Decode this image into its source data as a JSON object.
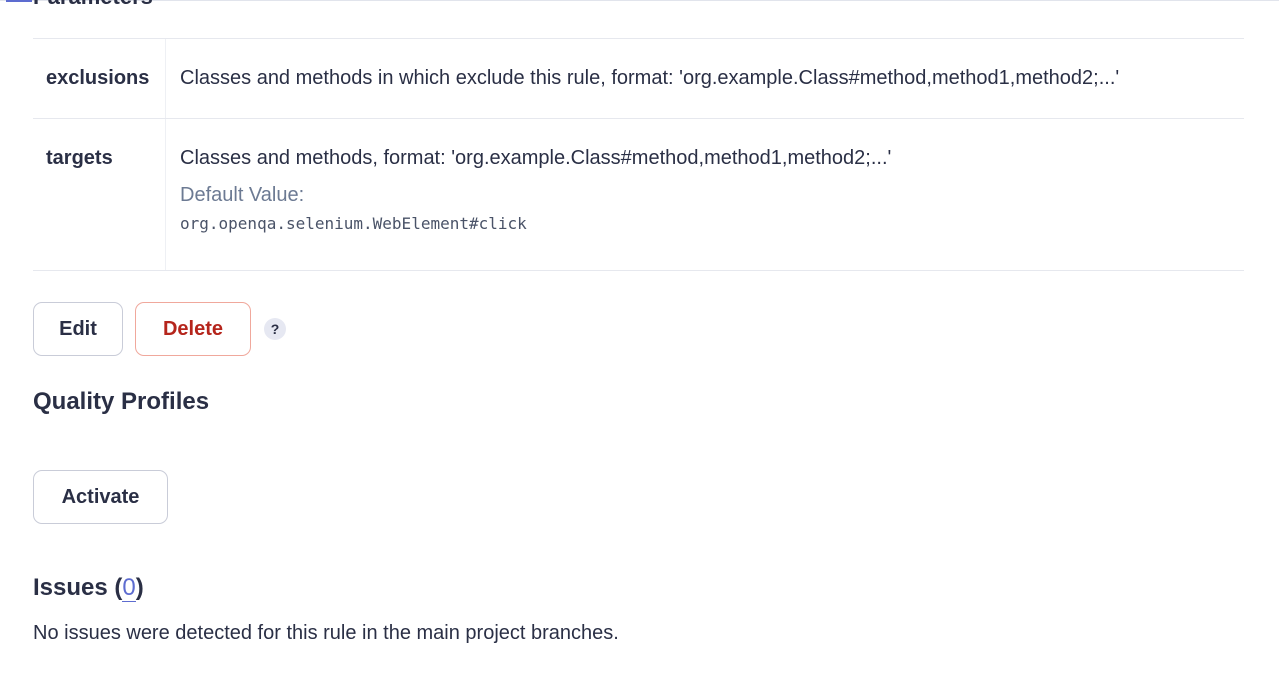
{
  "section": {
    "heading": "Parameters"
  },
  "parameters": [
    {
      "key": "exclusions",
      "description": "Classes and methods in which exclude this rule, format: 'org.example.Class#method,method1,method2;...'"
    },
    {
      "key": "targets",
      "description": "Classes and methods, format: 'org.example.Class#method,method1,method2;...'",
      "default_label": "Default Value:",
      "default_value": "org.openqa.selenium.WebElement#click"
    }
  ],
  "actions": {
    "edit_label": "Edit",
    "delete_label": "Delete",
    "help_glyph": "?"
  },
  "quality_profiles": {
    "heading": "Quality Profiles",
    "activate_label": "Activate"
  },
  "issues": {
    "heading_prefix": "Issues (",
    "count": "0",
    "heading_suffix": ")",
    "empty_text": "No issues were detected for this rule in the main project branches."
  },
  "colors": {
    "accent": "#5d6cd0",
    "danger": "#b5251c",
    "text": "#2a2f45",
    "muted": "#6c7a93"
  }
}
